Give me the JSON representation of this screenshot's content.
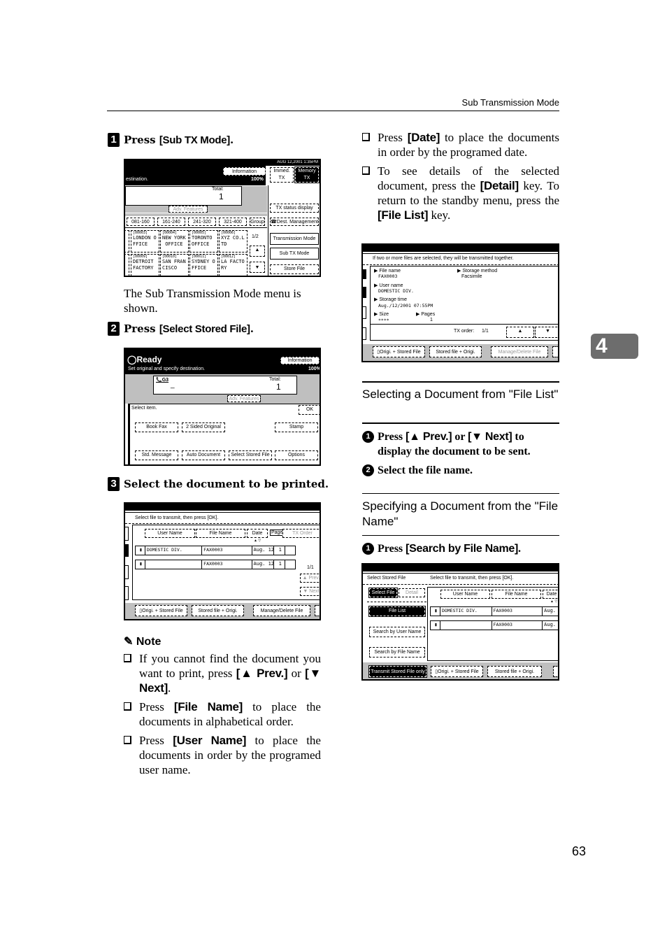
{
  "header": {
    "title": "Sub Transmission Mode"
  },
  "chapter_tab": "4",
  "page_number": "63",
  "left": {
    "step1": {
      "num": "1",
      "pre": "Press ",
      "key": "[Sub TX Mode]",
      "post": "."
    },
    "screen1": {
      "date": "AUG  12,2001  1:35PM",
      "info_btn": "Information",
      "msg": "estination.",
      "memory": "100%",
      "total_label": "Total:",
      "total_value": "1",
      "adv_features": "Adv. Features",
      "immed_tx": [
        "Immed.",
        "TX"
      ],
      "memory_tx": [
        "Memory",
        "TX"
      ],
      "tx_status": "TX status display",
      "dest_mgmt": "Dest. Management",
      "ranges": [
        "081-160",
        "161-240",
        "241-320",
        "321-400"
      ],
      "group": "Group",
      "page_ind": "1/2",
      "transmission_mode": "Transmission Mode",
      "sub_tx_mode": "Sub TX Mode",
      "store_file": "Store File",
      "dests": [
        {
          "code": "[00003]",
          "l1": "LONDON O",
          "l2": "FFICE"
        },
        {
          "code": "[00004]",
          "l1": "NEW YORK",
          "l2": " OFFICE"
        },
        {
          "code": "[00005]",
          "l1": "TORONTO",
          "l2": "OFFICE"
        },
        {
          "code": "[00006]",
          "l1": "XYZ CO.L",
          "l2": "TD"
        },
        {
          "code": "[00009]",
          "l1": "DETROIT",
          "l2": "FACTORY"
        },
        {
          "code": "[00010]",
          "l1": "SAN FRAN",
          "l2": "CISCO"
        },
        {
          "code": "[00011]",
          "l1": "SYDNEY O",
          "l2": "FFICE"
        },
        {
          "code": "[00012]",
          "l1": "LA FACTO",
          "l2": "RY"
        }
      ]
    },
    "caption1": "The Sub Transmission Mode menu is shown.",
    "step2": {
      "num": "2",
      "pre": "Press ",
      "key": "[Select Stored File]",
      "post": "."
    },
    "screen2": {
      "status": "Ready",
      "info_btn": "Information",
      "msg": "Set original and specify destination.",
      "memory": "100%",
      "g3": "G3",
      "cursor": "_",
      "total_label": "Total:",
      "total_value": "1",
      "adv_features": "Adv. Features",
      "select_item": "Select item.",
      "ok": "OK",
      "buttons": [
        "Book Fax",
        "2 Sided Original",
        "Stamp",
        "Std. Message",
        "Auto Document",
        "Select Stored File",
        "Options"
      ]
    },
    "step3": {
      "num": "3",
      "text": "Select the document to be printed."
    },
    "screen3": {
      "msg": "Select file to transmit, then press [OK].",
      "cols": [
        "User Name",
        "File Name",
        "Date",
        "Page",
        "TX Order"
      ],
      "rows": [
        {
          "user": "DOMESTIC DIV.",
          "file": "FAX0003",
          "date": "Aug.  12",
          "page": "1"
        },
        {
          "user": "",
          "file": "FAX0003",
          "date": "Aug.  12",
          "page": "1"
        }
      ],
      "page_ind": "1/1",
      "prev": "▲ Prev.",
      "next": "▼ Next",
      "bottom": [
        "Origi. + Stored File",
        "Stored file + Origi.",
        "Manage/Delete File"
      ]
    },
    "note": {
      "title": "Note",
      "items": [
        {
          "parts": [
            {
              "t": "If you cannot find the document you want to print, press "
            },
            {
              "k": "[▲ Prev.]"
            },
            {
              "t": " or "
            },
            {
              "k": "[▼ Next]"
            },
            {
              "t": "."
            }
          ]
        },
        {
          "parts": [
            {
              "t": "Press "
            },
            {
              "k": "[File Name]"
            },
            {
              "t": " to place the documents in alphabetical order."
            }
          ]
        },
        {
          "parts": [
            {
              "t": "Press "
            },
            {
              "k": "[User Name]"
            },
            {
              "t": " to place the documents in order by the programed user name."
            }
          ]
        }
      ]
    }
  },
  "right": {
    "bullets": [
      {
        "parts": [
          {
            "t": "Press "
          },
          {
            "k": "[Date]"
          },
          {
            "t": " to place the documents in order by the programed date."
          }
        ]
      },
      {
        "parts": [
          {
            "t": "To see details of the selected document, press the "
          },
          {
            "k": "[Detail]"
          },
          {
            "t": " key. To return to the standby menu, press the "
          },
          {
            "k": "[File List]"
          },
          {
            "t": " key."
          }
        ]
      }
    ],
    "screen4": {
      "msg": "If two or more files are selected, they will be transmitted together.",
      "file_name_label": "File name",
      "file_name": "FAX0003",
      "storage_method_label": "Storage method",
      "storage_method": "Facsimile",
      "user_name_label": "User name",
      "user_name": "DOMESTIC DIV.",
      "storage_time_label": "Storage time",
      "storage_time": "Aug./12/2001 07:55PM",
      "size_label": "Size",
      "size": "****",
      "pages_label": "Pages",
      "pages": "1",
      "tx_order_label": "TX order:",
      "tx_order": "1/1",
      "bottom": [
        "Origi. + Stored File",
        "Stored file + Origi.",
        "Manage/Delete File"
      ]
    },
    "section1": {
      "title": "Selecting a Document from \"File List\"",
      "steps": [
        {
          "num": "1",
          "parts": [
            {
              "t": "Press "
            },
            {
              "k": "[▲ Prev.]"
            },
            {
              "t": " or "
            },
            {
              "k": "[▼ Next]"
            },
            {
              "t": " to display the document to be sent."
            }
          ]
        },
        {
          "num": "2",
          "parts": [
            {
              "t": "Select the file name."
            }
          ]
        }
      ]
    },
    "section2": {
      "title": "Specifying a Document from the \"File Name\"",
      "steps": [
        {
          "num": "1",
          "parts": [
            {
              "t": "Press "
            },
            {
              "k": "[Search by File Name]"
            },
            {
              "t": "."
            }
          ]
        }
      ]
    },
    "screen5": {
      "title": "Select Stored File",
      "msg": "Select file to transmit, then press [OK].",
      "select_file": "Select File",
      "detail": "Detail",
      "file_list": "File List",
      "search_user": "Search by User Name",
      "search_file": "Search by File Name",
      "cols": [
        "User Name",
        "File Name",
        "Date"
      ],
      "rows": [
        {
          "user": "DOMESTIC DIV.",
          "file": "FAX0003",
          "date": "Aug."
        },
        {
          "user": "",
          "file": "FAX0003",
          "date": "Aug."
        }
      ],
      "bottom": [
        "Transmit Stored File only",
        "Origi. + Stored File",
        "Stored file + Origi."
      ]
    }
  }
}
